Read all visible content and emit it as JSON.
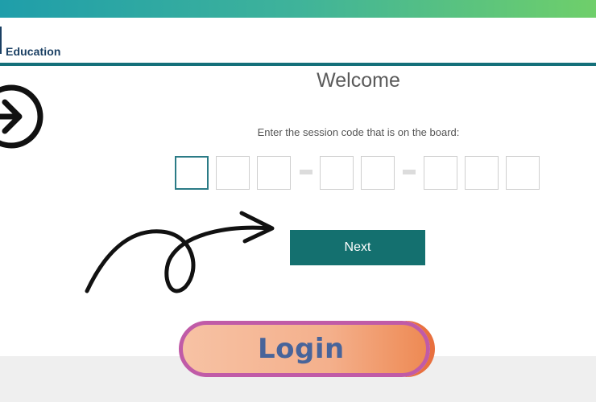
{
  "header": {
    "brand_text": "Education"
  },
  "main": {
    "title": "Welcome",
    "instruction": "Enter the session code that is on the board:",
    "code_groups": [
      3,
      2,
      3
    ],
    "next_label": "Next"
  },
  "overlay": {
    "login_label": "Login",
    "circle_icon": "arrow-right-circle-icon",
    "drawn_arrow_icon": "curly-arrow-icon"
  },
  "colors": {
    "accent": "#14706f",
    "brand": "#1a3f63",
    "header_gradient_start": "#1f9eaa",
    "header_gradient_end": "#6fcf6a",
    "login_border": "#c05ba7",
    "login_text": "#48649a"
  }
}
